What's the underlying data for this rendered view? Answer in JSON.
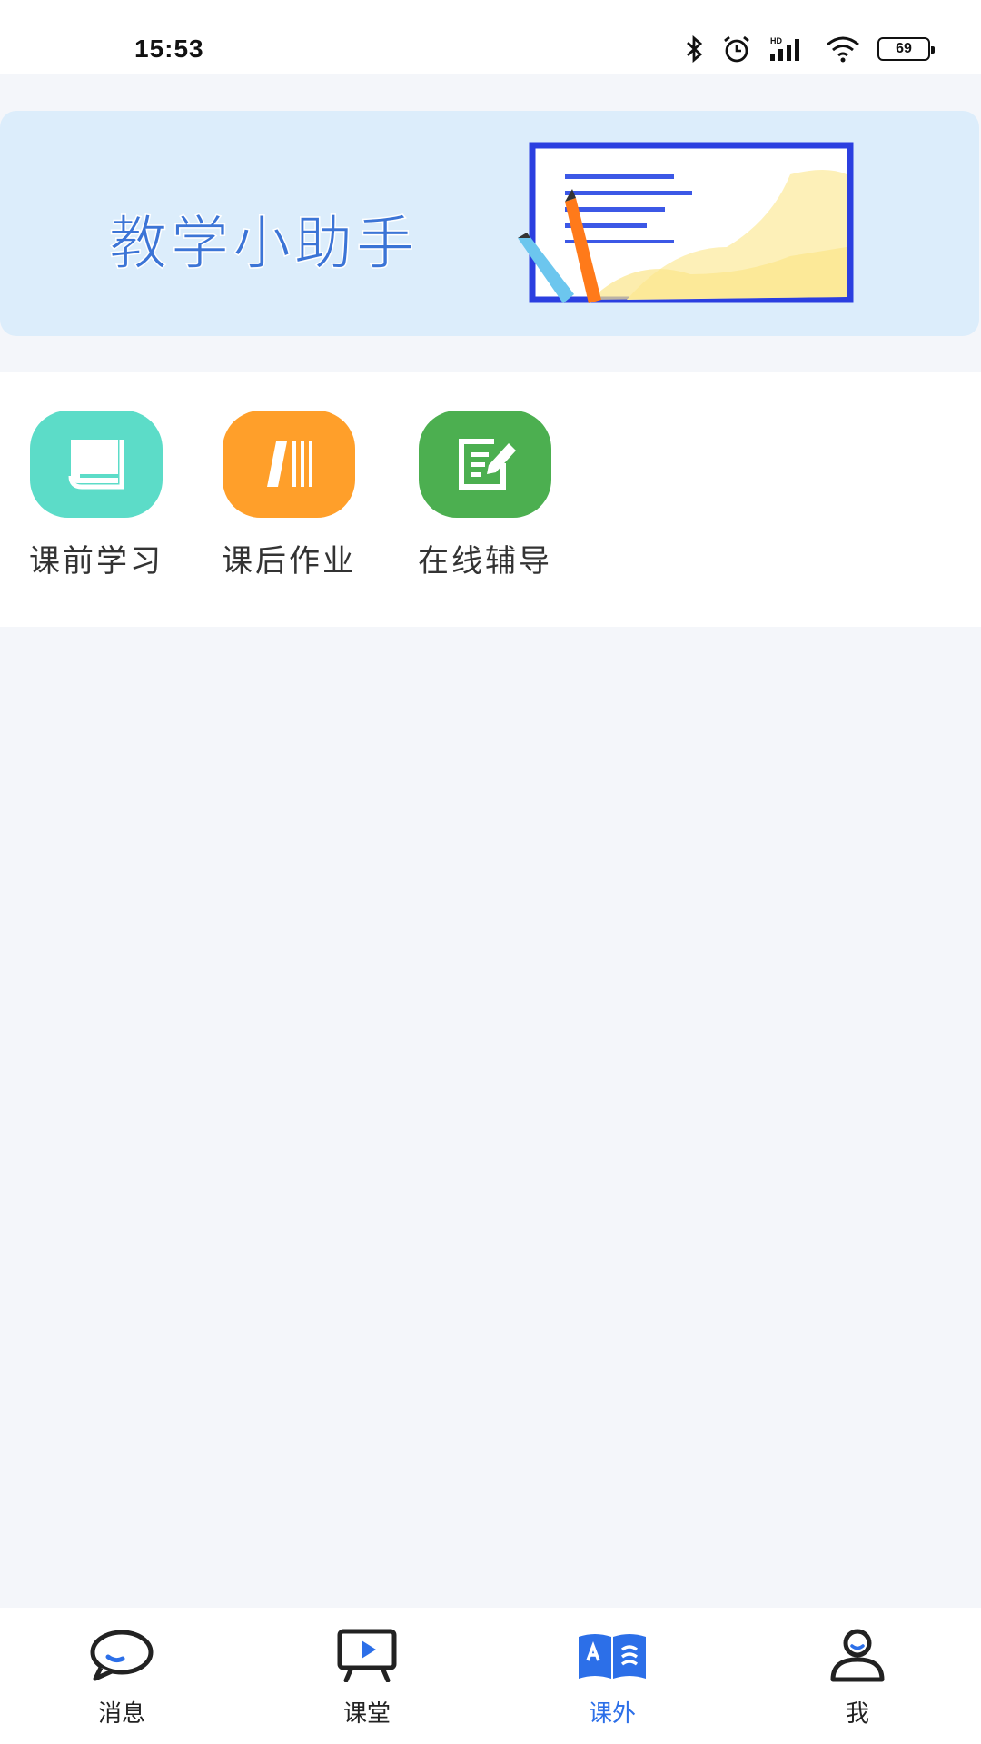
{
  "status": {
    "time": "15:53",
    "battery": "69"
  },
  "banner": {
    "title": "教学小助手"
  },
  "quick_actions": [
    {
      "label": "课前学习",
      "color": "#5cdcc8",
      "icon": "book-icon"
    },
    {
      "label": "课后作业",
      "color": "#ff9f2a",
      "icon": "homework-books-icon"
    },
    {
      "label": "在线辅导",
      "color": "#4caf50",
      "icon": "edit-note-icon"
    }
  ],
  "tabs": [
    {
      "label": "消息",
      "icon": "chat-bubble-icon"
    },
    {
      "label": "课堂",
      "icon": "classroom-screen-icon"
    },
    {
      "label": "课外",
      "icon": "open-book-icon",
      "active": true
    },
    {
      "label": "我",
      "icon": "user-icon"
    }
  ],
  "colors": {
    "accent": "#2c6fe8",
    "background": "#f4f6fa"
  }
}
